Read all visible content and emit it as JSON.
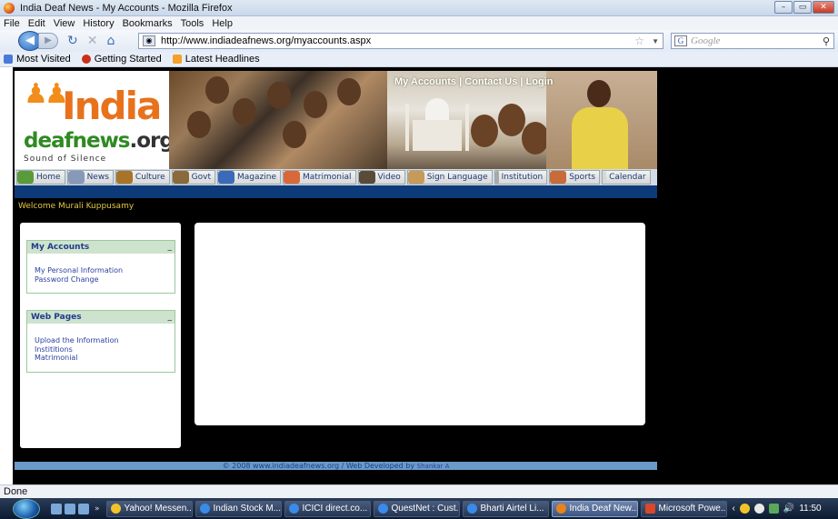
{
  "window": {
    "title": "India Deaf News - My Accounts - Mozilla Firefox"
  },
  "menu": [
    "File",
    "Edit",
    "View",
    "History",
    "Bookmarks",
    "Tools",
    "Help"
  ],
  "nav": {
    "url": "http://www.indiadeafnews.org/myaccounts.aspx",
    "search_placeholder": "Google"
  },
  "bookmarks": [
    "Most Visited",
    "Getting Started",
    "Latest Headlines"
  ],
  "banner": {
    "logo_india": "India",
    "logo_deaf": "deafnews",
    "logo_org": ".org",
    "tagline": "Sound of Silence",
    "links": [
      "My Accounts",
      "Contact Us",
      "Login"
    ]
  },
  "tabs": [
    {
      "label": "Home",
      "color": "#5a9a3a"
    },
    {
      "label": "News",
      "color": "#8898b8"
    },
    {
      "label": "Culture",
      "color": "#a8742a"
    },
    {
      "label": "Govt",
      "color": "#8a6a3a"
    },
    {
      "label": "Magazine",
      "color": "#3a6ab8"
    },
    {
      "label": "Matrimonial",
      "color": "#d8683a"
    },
    {
      "label": "Video",
      "color": "#5a4a3a"
    },
    {
      "label": "Sign Language",
      "color": "#c89a5a"
    },
    {
      "label": "Institution",
      "color": "#a8a8a8"
    },
    {
      "label": "Sports",
      "color": "#c86a3a"
    },
    {
      "label": "Calendar",
      "color": "#d8d8d8"
    }
  ],
  "welcome": "Welcome Murali Kuppusamy",
  "my_accounts": {
    "title": "My Accounts",
    "items": [
      "My Personal Information",
      "Password Change"
    ]
  },
  "web_pages": {
    "title": "Web Pages",
    "items": [
      "Upload the Information",
      "Instititions",
      "Matrimonial"
    ]
  },
  "footer": {
    "text": "© 2008 www.indiadeafnews.org / Web Developed by",
    "author": "Shankar A"
  },
  "status": "Done",
  "taskbar": {
    "tasks": [
      {
        "label": "Yahoo! Messen...",
        "color": "#f2c22a"
      },
      {
        "label": "Indian Stock M...",
        "color": "#3a8ae8"
      },
      {
        "label": "ICICI direct.co...",
        "color": "#3a8ae8"
      },
      {
        "label": "QuestNet : Cust...",
        "color": "#3a8ae8"
      },
      {
        "label": "Bharti Airtel Li...",
        "color": "#3a8ae8"
      },
      {
        "label": "India Deaf New...",
        "color": "#e8821a"
      },
      {
        "label": "Microsoft Powe...",
        "color": "#d8482a"
      }
    ],
    "clock": "11:50"
  }
}
